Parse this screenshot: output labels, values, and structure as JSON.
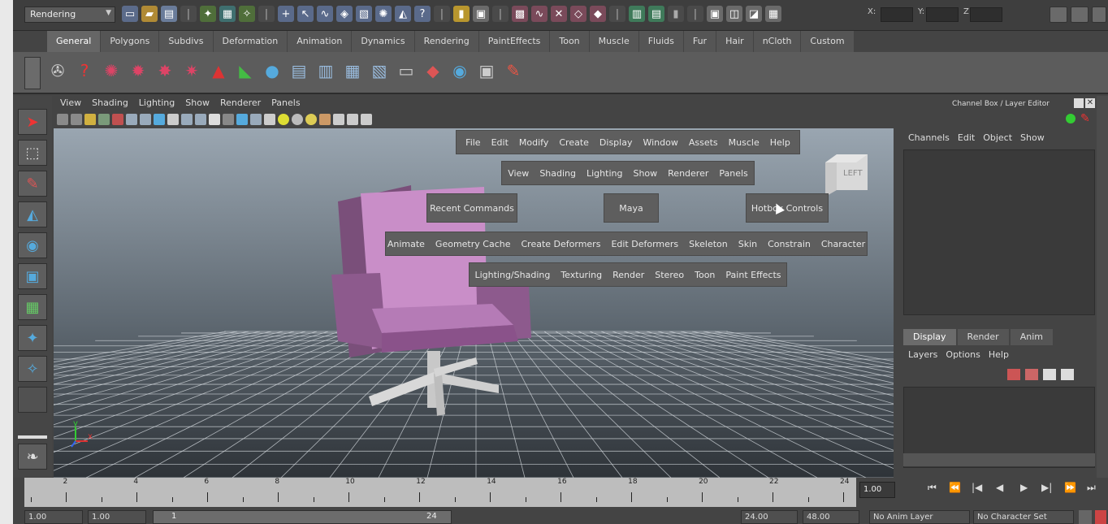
{
  "status_line": {
    "mode": "Rendering",
    "x_label": "X:",
    "y_label": "Y:",
    "z_label": "Z:"
  },
  "shelf_tabs": [
    "General",
    "Polygons",
    "Subdivs",
    "Deformation",
    "Animation",
    "Dynamics",
    "Rendering",
    "PaintEffects",
    "Toon",
    "Muscle",
    "Fluids",
    "Fur",
    "Hair",
    "nCloth",
    "Custom"
  ],
  "active_shelf_tab": "General",
  "viewport_menu": [
    "View",
    "Shading",
    "Lighting",
    "Show",
    "Renderer",
    "Panels"
  ],
  "viewcube_label": "LEFT",
  "hotbox": {
    "main_menu": [
      "File",
      "Edit",
      "Modify",
      "Create",
      "Display",
      "Window",
      "Assets",
      "Muscle",
      "Help"
    ],
    "panel_menu": [
      "View",
      "Shading",
      "Lighting",
      "Show",
      "Renderer",
      "Panels"
    ],
    "recent": "Recent Commands",
    "center": "Maya",
    "hotbox_controls": "Hotbox Controls",
    "animate_row": [
      "Animate",
      "Geometry Cache",
      "Create Deformers",
      "Edit Deformers",
      "Skeleton",
      "Skin",
      "Constrain",
      "Character"
    ],
    "render_row": [
      "Lighting/Shading",
      "Texturing",
      "Render",
      "Stereo",
      "Toon",
      "Paint Effects"
    ]
  },
  "channel_box": {
    "title": "Channel Box / Layer Editor",
    "menu": [
      "Channels",
      "Edit",
      "Object",
      "Show"
    ]
  },
  "layer_editor": {
    "tabs": [
      "Display",
      "Render",
      "Anim"
    ],
    "active_tab": "Display",
    "menu": [
      "Layers",
      "Options",
      "Help"
    ]
  },
  "time_slider": {
    "labels": [
      "2",
      "4",
      "6",
      "8",
      "10",
      "12",
      "14",
      "16",
      "18",
      "20",
      "22",
      "24"
    ],
    "current_frame": "1.00"
  },
  "range_slider": {
    "start_time": "1.00",
    "playback_start": "1.00",
    "range_start": "1",
    "range_end": "24",
    "playback_end": "24.00",
    "end_time": "48.00",
    "anim_layer": "No Anim Layer",
    "character_set": "No Character Set"
  },
  "axis": {
    "y": "y",
    "x": "x"
  }
}
